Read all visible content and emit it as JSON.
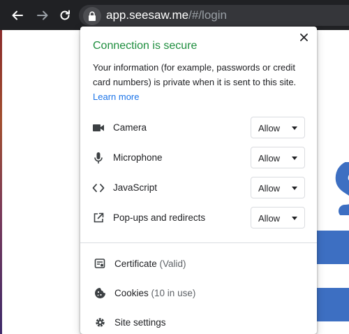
{
  "browser": {
    "url_host": "app.seesaw.me",
    "url_path": "/#/login"
  },
  "popup": {
    "title": "Connection is secure",
    "description": "Your information (for example, passwords or credit card numbers) is private when it is sent to this site.",
    "learn_more": "Learn more",
    "permissions": [
      {
        "icon": "camera-icon",
        "label": "Camera",
        "value": "Allow"
      },
      {
        "icon": "microphone-icon",
        "label": "Microphone",
        "value": "Allow"
      },
      {
        "icon": "code-icon",
        "label": "JavaScript",
        "value": "Allow"
      },
      {
        "icon": "popup-icon",
        "label": "Pop-ups and redirects",
        "value": "Allow"
      }
    ],
    "info_rows": [
      {
        "icon": "certificate-icon",
        "label": "Certificate",
        "sub": "(Valid)"
      },
      {
        "icon": "cookie-icon",
        "label": "Cookies",
        "sub": "(10 in use)"
      },
      {
        "icon": "gear-icon",
        "label": "Site settings",
        "sub": ""
      }
    ]
  },
  "colors": {
    "title_green": "#1e8e3e",
    "link_blue": "#1a73e8",
    "page_blue": "#3d6fc2",
    "toolbar": "#202124"
  }
}
